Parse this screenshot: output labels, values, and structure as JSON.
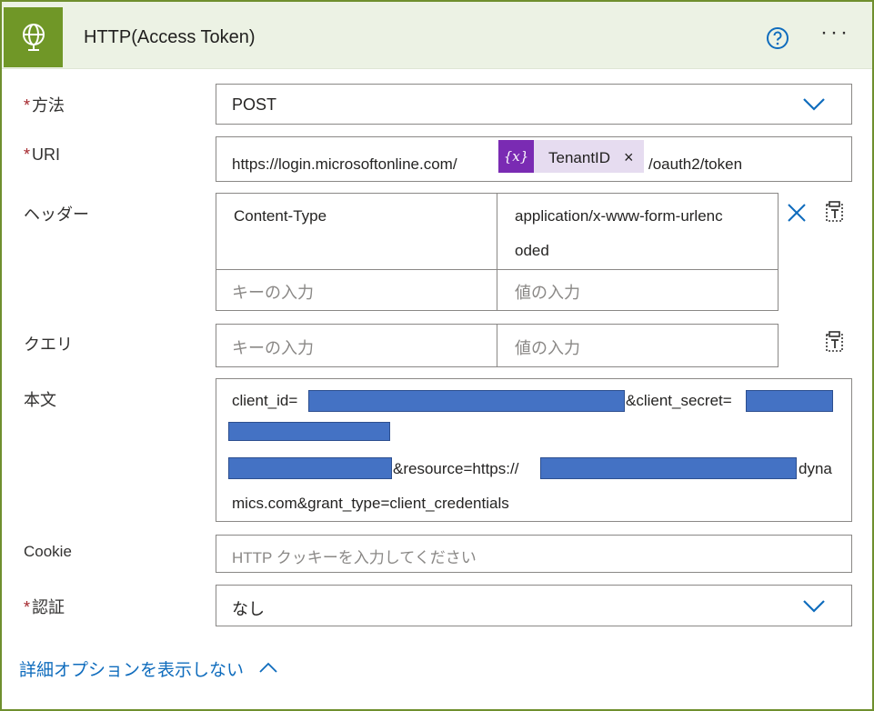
{
  "header": {
    "title": "HTTP(Access Token)",
    "more_label": "···"
  },
  "method": {
    "label": "方法",
    "required_mark": "*",
    "value": "POST"
  },
  "uri": {
    "label": "URI",
    "required_mark": "*",
    "prefix": "https://login.microsoftonline.com/",
    "token_icon_text": "{x}",
    "token_label": "TenantID",
    "token_remove": "×",
    "suffix": "/oauth2/token"
  },
  "headers": {
    "label": "ヘッダー",
    "rows": [
      {
        "key": "Content-Type",
        "value_line1": "application/x-www-form-urlenc",
        "value_line2": "oded"
      }
    ],
    "key_placeholder": "キーの入力",
    "value_placeholder": "値の入力"
  },
  "query": {
    "label": "クエリ",
    "key_placeholder": "キーの入力",
    "value_placeholder": "値の入力"
  },
  "body": {
    "label": "本文",
    "part1": "client_id=",
    "part2": "&client_secret=",
    "part3": "&resource=https://",
    "part4": "dyna",
    "line4": "mics.com&grant_type=client_credentials"
  },
  "cookie": {
    "label": "Cookie",
    "placeholder": "HTTP クッキーを入力してください"
  },
  "auth": {
    "label": "認証",
    "required_mark": "*",
    "value": "なし"
  },
  "advanced": {
    "label": "詳細オプションを表示しない"
  },
  "colors": {
    "accent_green": "#709727",
    "token_purple": "#7a2bb3",
    "link_blue": "#0f6cbd",
    "redaction_blue": "#4472c4"
  }
}
